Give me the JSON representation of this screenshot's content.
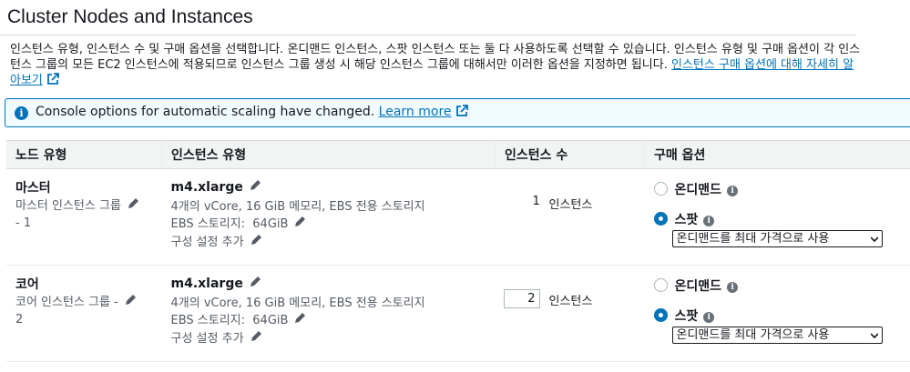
{
  "page": {
    "title": "Cluster Nodes and Instances",
    "description": "인스턴스 유형, 인스턴스 수 및 구매 옵션을 선택합니다. 온디맨드 인스턴스, 스팟 인스턴스 또는 둘 다 사용하도록 선택할 수 있습니다. 인스턴스 유형 및 구매 옵션이 각 인스턴스 그룹의 모든 EC2 인스턴스에 적용되므로 인스턴스 그룹 생성 시 해당 인스턴스 그룹에 대해서만 이러한 옵션을 지정하면 됩니다.",
    "description_link": "인스턴스 구매 옵션에 대해 자세히 알아보기"
  },
  "banner": {
    "text": "Console options for automatic scaling have changed.",
    "link": "Learn more"
  },
  "table": {
    "headers": [
      "노드 유형",
      "인스턴스 유형",
      "인스턴스 수",
      "구매 옵션"
    ],
    "rows": [
      {
        "node_type": "마스터",
        "group_line1": "마스터 인스턴스 그룹",
        "group_line2": "- 1",
        "instance_type": "m4.xlarge",
        "specs": "4개의 vCore, 16 GiB 메모리, EBS 전용 스토리지",
        "ebs_label": "EBS 스토리지:",
        "ebs_value": "64GiB",
        "config": "구성 설정 추가",
        "count": "1",
        "count_unit": "인스턴스",
        "option_ondemand": "온디맨드",
        "option_spot": "스팟",
        "selected_option": "spot",
        "spot_price": "온디맨드를 최대 가격으로 사용"
      },
      {
        "node_type": "코어",
        "group_line1": "코어 인스턴스 그룹 -",
        "group_line2": "2",
        "instance_type": "m4.xlarge",
        "specs": "4개의 vCore, 16 GiB 메모리, EBS 전용 스토리지",
        "ebs_label": "EBS 스토리지:",
        "ebs_value": "64GiB",
        "config": "구성 설정 추가",
        "count": "2",
        "count_unit": "인스턴스",
        "option_ondemand": "온디맨드",
        "option_spot": "스팟",
        "selected_option": "spot",
        "spot_price": "온디맨드를 최대 가격으로 사용"
      }
    ]
  },
  "colors": {
    "link": "#0073bb",
    "header_bg": "#f2f3f3",
    "banner_bg": "#f1faff"
  },
  "icons": {
    "edit": "pencil-icon",
    "external": "external-link-icon",
    "info": "info-icon"
  }
}
